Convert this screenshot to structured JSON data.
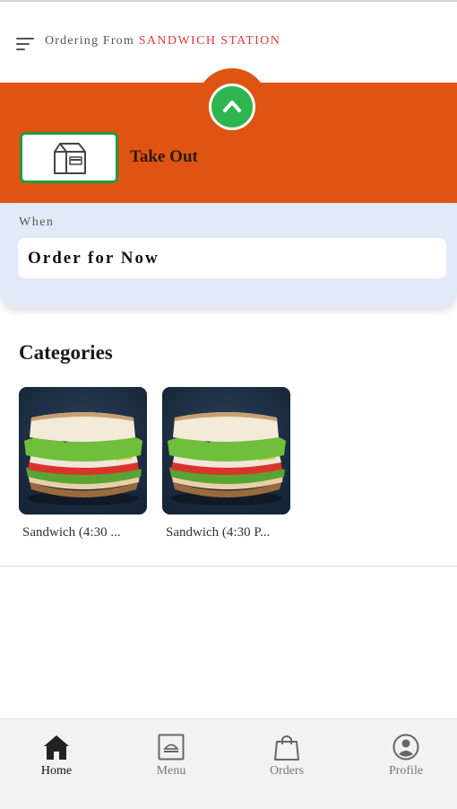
{
  "header": {
    "ordering_prefix": "Ordering From",
    "store_name": "SANDWICH STATION"
  },
  "order_type": {
    "label": "Take Out",
    "colors": {
      "band": "#e05413",
      "accent": "#2eb551"
    }
  },
  "when": {
    "label": "When",
    "value": "Order for Now"
  },
  "categories": {
    "title": "Categories",
    "items": [
      {
        "label": "Sandwich (4:30 ...",
        "image": "sandwich-photo"
      },
      {
        "label": "Sandwich (4:30 P...",
        "image": "sandwich-photo"
      }
    ]
  },
  "bottom_nav": {
    "items": [
      {
        "label": "Home",
        "icon": "home-icon",
        "active": true
      },
      {
        "label": "Menu",
        "icon": "menu-icon",
        "active": false
      },
      {
        "label": "Orders",
        "icon": "shopping-bag-icon",
        "active": false
      },
      {
        "label": "Profile",
        "icon": "profile-icon",
        "active": false
      }
    ]
  }
}
